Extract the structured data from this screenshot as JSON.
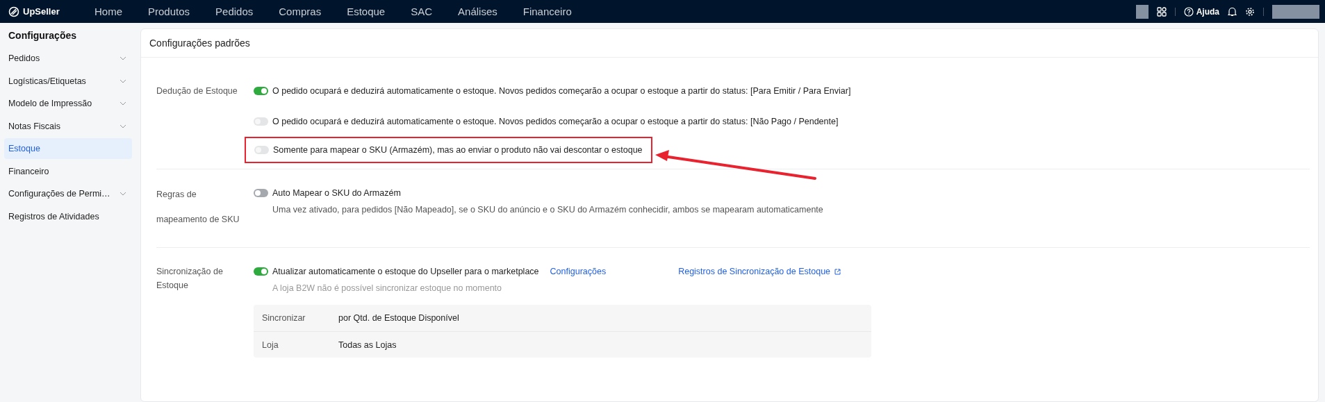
{
  "topbar": {
    "brand": "UpSeller",
    "nav": [
      "Home",
      "Produtos",
      "Pedidos",
      "Compras",
      "Estoque",
      "SAC",
      "Análises",
      "Financeiro"
    ],
    "help": "Ajuda"
  },
  "sidebar": {
    "title": "Configurações",
    "items": [
      {
        "label": "Pedidos",
        "expandable": true,
        "selected": false
      },
      {
        "label": "Logísticas/Etiquetas",
        "expandable": true,
        "selected": false
      },
      {
        "label": "Modelo de Impressão",
        "expandable": true,
        "selected": false
      },
      {
        "label": "Notas Fiscais",
        "expandable": true,
        "selected": false
      },
      {
        "label": "Estoque",
        "expandable": false,
        "selected": true
      },
      {
        "label": "Financeiro",
        "expandable": false,
        "selected": false
      },
      {
        "label": "Configurações de Permi…",
        "expandable": true,
        "selected": false
      },
      {
        "label": "Registros de Atividades",
        "expandable": false,
        "selected": false
      }
    ]
  },
  "panel": {
    "title": "Configurações padrões",
    "sections": [
      {
        "label": "Dedução de Estoque",
        "options": [
          {
            "text": "O pedido ocupará e deduzirá automaticamente o estoque. Novos pedidos começarão a ocupar o estoque a partir do status: [Para Emitir / Para Enviar]",
            "on": true,
            "disabled": false,
            "highlighted": false
          },
          {
            "text": "O pedido ocupará e deduzirá automaticamente o estoque. Novos pedidos começarão a ocupar o estoque a partir do status: [Não Pago / Pendente]",
            "on": false,
            "disabled": true,
            "highlighted": false
          },
          {
            "text": "Somente para mapear o SKU (Armazém), mas ao enviar o produto não vai descontar o estoque",
            "on": false,
            "disabled": true,
            "highlighted": true
          }
        ]
      },
      {
        "label": "Regras de mapeamento de SKU",
        "options": [
          {
            "text": "Auto Mapear o SKU do Armazém",
            "note": "Uma vez ativado, para pedidos [Não Mapeado], se o SKU do anúncio e o SKU do Armazém conhecidir, ambos se mapearam automaticamente",
            "on": false,
            "disabled": false,
            "highlighted": false
          }
        ]
      },
      {
        "label": "Sincronização de Estoque",
        "options": [
          {
            "text": "Atualizar automaticamente o estoque do Upseller para o marketplace",
            "link": "Configurações",
            "right_link": "Registros de Sincronização de Estoque",
            "note": "A loja B2W não é possível sincronizar estoque no momento",
            "on": true,
            "disabled": false,
            "highlighted": false
          }
        ],
        "table": [
          {
            "key": "Sincronizar",
            "value": "por Qtd. de Estoque Disponível"
          },
          {
            "key": "Loja",
            "value": "Todas as Lojas"
          }
        ]
      }
    ]
  }
}
